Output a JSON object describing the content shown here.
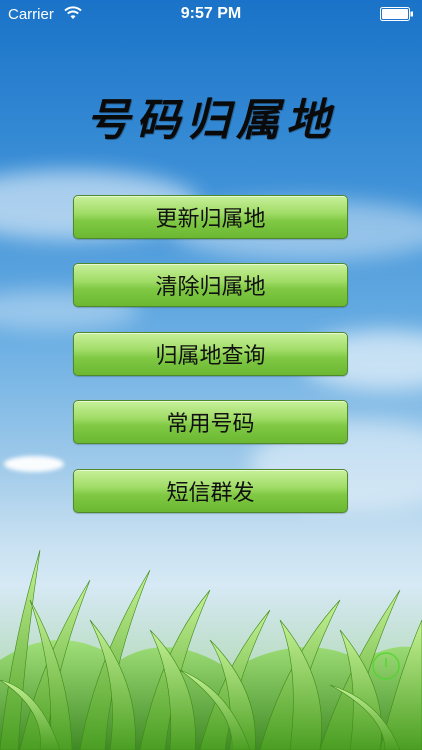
{
  "status_bar": {
    "carrier": "Carrier",
    "time": "9:57 PM",
    "icons": [
      "wifi-icon",
      "battery-icon"
    ]
  },
  "title": "号码归属地",
  "menu": {
    "buttons": [
      {
        "label": "更新归属地"
      },
      {
        "label": "清除归属地"
      },
      {
        "label": "归属地查询"
      },
      {
        "label": "常用号码"
      },
      {
        "label": "短信群发"
      }
    ]
  },
  "colors": {
    "button_top": "#c7f09a",
    "button_bottom": "#6bb832",
    "sky": "#1a73c8",
    "grass": "#3f9a1e"
  }
}
